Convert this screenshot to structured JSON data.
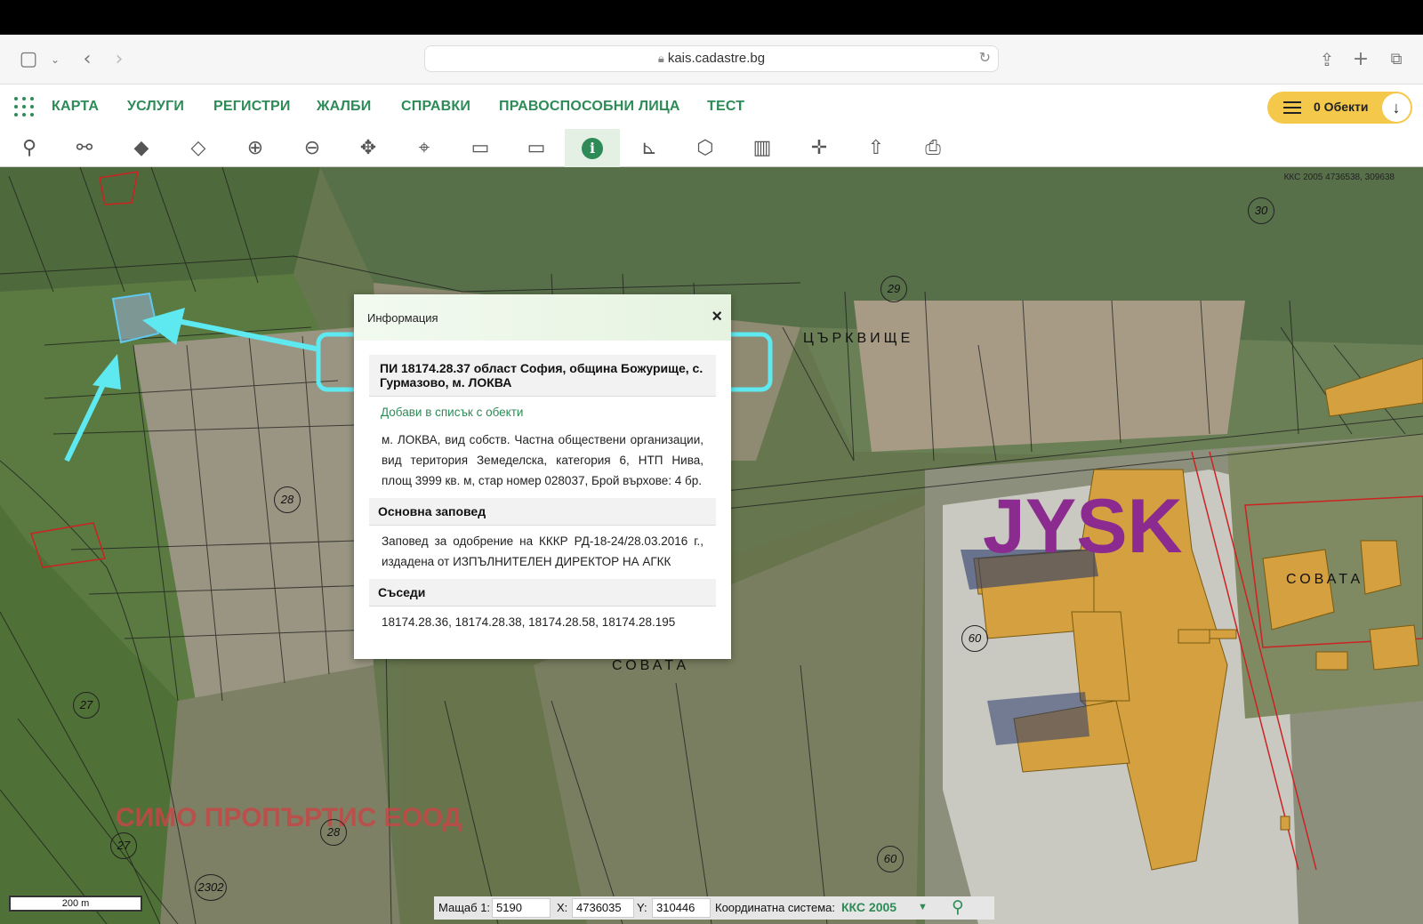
{
  "browser": {
    "url": "kais.cadastre.bg"
  },
  "nav": {
    "items": [
      "КАРТА",
      "УСЛУГИ",
      "РЕГИСТРИ",
      "ЖАЛБИ",
      "СПРАВКИ",
      "ПРАВОСПОСОБНИ ЛИЦА",
      "ТЕСТ"
    ],
    "objects_label": "0 Обекти"
  },
  "toolbar": {
    "tools": [
      "search-icon",
      "route-icon",
      "layers-filled-icon",
      "layers-icon",
      "zoom-in-icon",
      "zoom-out-icon",
      "pan-icon",
      "marker-icon",
      "select-add-icon",
      "select-remove-icon",
      "info-icon",
      "measure-icon",
      "polygon-icon",
      "map-book-icon",
      "crosshair-icon",
      "export-icon",
      "print-icon"
    ],
    "active": "info-icon"
  },
  "map": {
    "coord_readout": "ККС 2005 4736538, 309638",
    "labels": {
      "tsarkvishte": "ЦЪРКВИЩЕ",
      "sovata_center": "СОВАТА",
      "sovata_right": "СОВАТА",
      "jysk": "JYSK",
      "simo": "СИМО ПРОПЪРТИС ЕООД"
    },
    "numbers": [
      "30",
      "29",
      "28",
      "60",
      "27",
      "27",
      "28",
      "60",
      "2302"
    ]
  },
  "popup": {
    "title": "Информация",
    "parcel": "ПИ 18174.28.37 област София, община Божурище, с. Гурмазово, м. ЛОКВА",
    "add_link": "Добави в списък с обекти",
    "details": "м. ЛОКВА, вид собств. Частна обществени организации, вид територия Земеделска, категория 6, НТП Нива, площ 3999 кв. м, стар номер 028037, Брой върхове: 4 бр.",
    "order_heading": "Основна заповед",
    "order_text": "Заповед за одобрение на КККР РД-18-24/28.03.2016 г., издадена от ИЗПЪЛНИТЕЛЕН ДИРЕКТОР НА АГКК",
    "neighbors_heading": "Съседи",
    "neighbors": "18174.28.36, 18174.28.38, 18174.28.58, 18174.28.195"
  },
  "footer": {
    "scale_label": "Мащаб 1:",
    "scale_value": "5190",
    "x_label": "X:",
    "x_value": "4736035",
    "y_label": "Y:",
    "y_value": "310446",
    "cs_label": "Координатна система:",
    "cs_value": "ККС 2005",
    "scalebar": "200 m"
  },
  "colors": {
    "accent": "#2e8b57",
    "highlight": "#5ee8f0",
    "building": "#d4a040",
    "jysk": "#8b2a8f"
  }
}
